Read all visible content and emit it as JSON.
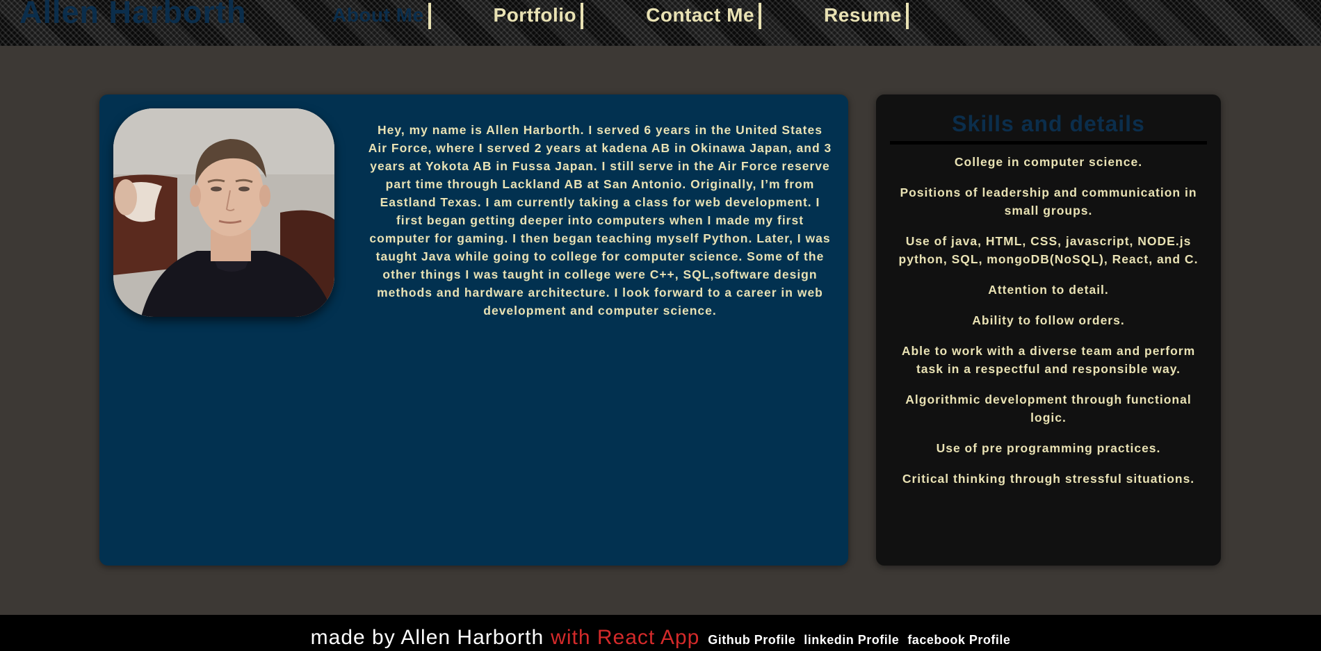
{
  "header": {
    "site_title": "Allen Harborth",
    "nav": [
      {
        "label": "About Me",
        "active": true
      },
      {
        "label": "Portfolio"
      },
      {
        "label": "Contact Me"
      },
      {
        "label": "Resume"
      }
    ]
  },
  "about": {
    "bio": "Hey, my name is Allen Harborth. I served 6 years in the United States Air Force, where I served 2 years at kadena AB in Okinawa Japan, and 3 years at Yokota AB in Fussa Japan. I still serve in the Air Force reserve part time through Lackland AB at San Antonio. Originally, I’m from Eastland Texas. I am currently taking a class for web development. I first began getting deeper into computers when I made my first computer for gaming. I then began teaching myself Python. Later, I was taught Java while going to college for computer science. Some of the other things I was taught in college were C++, SQL,software design methods and hardware architecture. I look forward to a career in web development and computer science."
  },
  "skills": {
    "title": "Skills and details",
    "items": [
      "College in computer science.",
      "Positions of leadership and communication in small groups.",
      "Use of java, HTML, CSS, javascript, NODE.js python, SQL, mongoDB(NoSQL), React, and C.",
      "Attention to detail.",
      "Ability to follow orders.",
      "Able to work with a diverse team and perform task in a respectful and responsible way.",
      "Algorithmic development through functional logic.",
      "Use of pre programming practices.",
      "Critical thinking through stressful situations."
    ]
  },
  "footer": {
    "made_by": "made by Allen Harborth",
    "with_react": "with React App",
    "links": [
      "Github Profile",
      "linkedin Profile",
      "facebook Profile"
    ]
  },
  "colors": {
    "page_bg": "#3d3935",
    "header_bg": "#0b0b0b",
    "accent_text": "#e9e2b4",
    "title_navy": "#0b2e4c",
    "about_card_bg": "#023150",
    "skills_card_bg": "#111111",
    "footer_bg": "#000000",
    "react_red": "#d42a2a"
  }
}
